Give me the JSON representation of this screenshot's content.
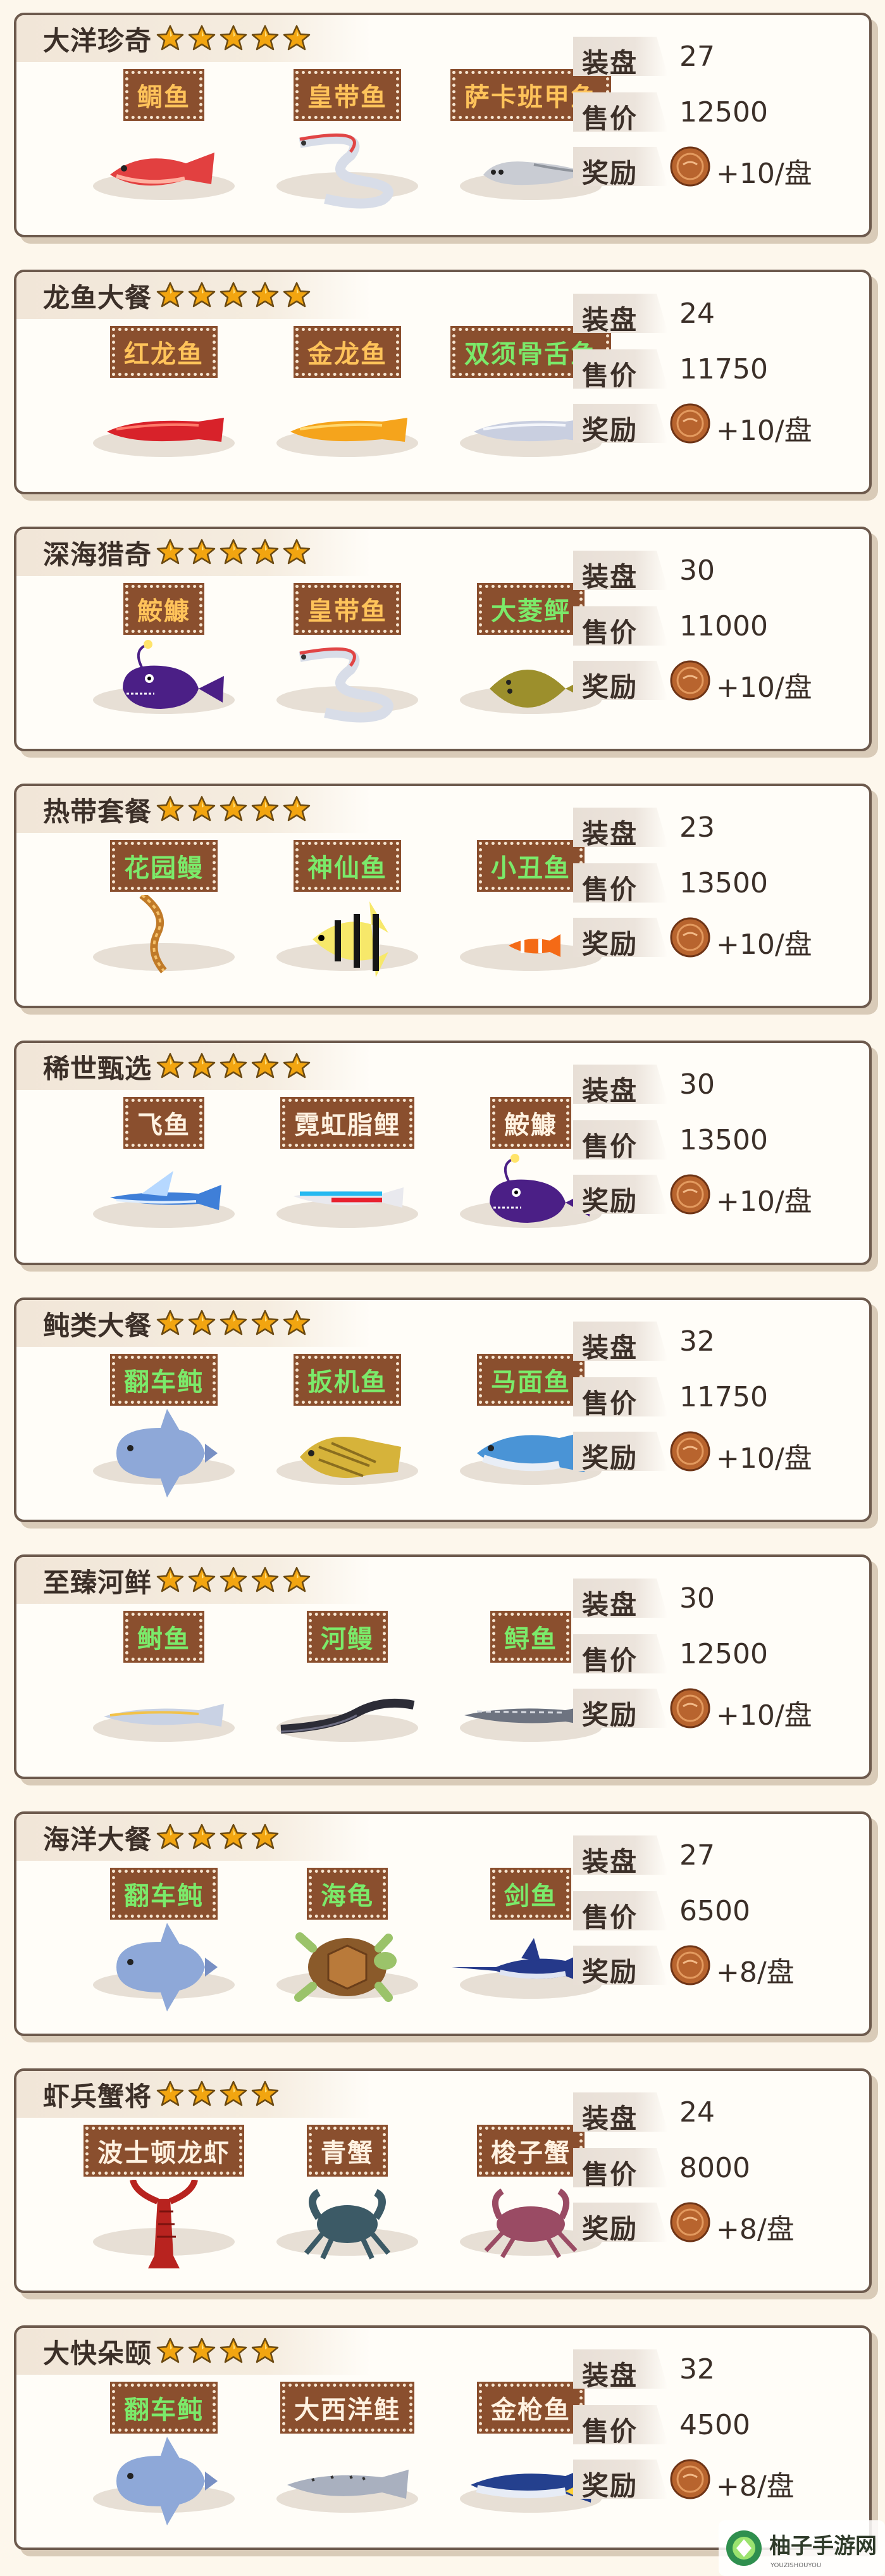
{
  "labels": {
    "plate": "装盘",
    "price": "售价",
    "reward": "奖励"
  },
  "colors": {
    "tag_orange": "#ffc35a",
    "tag_green": "#7bea6a",
    "star_gold": "#f2a510"
  },
  "sets": [
    {
      "title": "大洋珍奇",
      "stars": 5,
      "fish": [
        {
          "name": "鲷鱼",
          "tag_color": "orange",
          "icon": "red-snapper-icon"
        },
        {
          "name": "皇带鱼",
          "tag_color": "orange",
          "icon": "oarfish-icon"
        },
        {
          "name": "萨卡班甲鱼",
          "tag_color": "orange",
          "icon": "sacabambaspis-icon"
        }
      ],
      "plate": "27",
      "price": "12500",
      "reward": "+10/盘"
    },
    {
      "title": "龙鱼大餐",
      "stars": 5,
      "fish": [
        {
          "name": "红龙鱼",
          "tag_color": "orange",
          "icon": "red-arowana-icon"
        },
        {
          "name": "金龙鱼",
          "tag_color": "orange",
          "icon": "golden-arowana-icon"
        },
        {
          "name": "双须骨舌鱼",
          "tag_color": "green",
          "icon": "silver-arowana-icon"
        }
      ],
      "plate": "24",
      "price": "11750",
      "reward": "+10/盘"
    },
    {
      "title": "深海猎奇",
      "stars": 5,
      "fish": [
        {
          "name": "鮟鱇",
          "tag_color": "orange",
          "icon": "anglerfish-icon"
        },
        {
          "name": "皇带鱼",
          "tag_color": "orange",
          "icon": "oarfish-icon"
        },
        {
          "name": "大菱鲆",
          "tag_color": "green",
          "icon": "turbot-icon"
        }
      ],
      "plate": "30",
      "price": "11000",
      "reward": "+10/盘"
    },
    {
      "title": "热带套餐",
      "stars": 5,
      "fish": [
        {
          "name": "花园鳗",
          "tag_color": "green",
          "icon": "garden-eel-icon"
        },
        {
          "name": "神仙鱼",
          "tag_color": "green",
          "icon": "angelfish-icon"
        },
        {
          "name": "小丑鱼",
          "tag_color": "green",
          "icon": "clownfish-icon"
        }
      ],
      "plate": "23",
      "price": "13500",
      "reward": "+10/盘"
    },
    {
      "title": "稀世甄选",
      "stars": 5,
      "fish": [
        {
          "name": "飞鱼",
          "tag_color": "white",
          "icon": "flying-fish-icon"
        },
        {
          "name": "霓虹脂鲤",
          "tag_color": "white",
          "icon": "neon-tetra-icon"
        },
        {
          "name": "鮟鱇",
          "tag_color": "white",
          "icon": "anglerfish-icon"
        }
      ],
      "plate": "30",
      "price": "13500",
      "reward": "+10/盘"
    },
    {
      "title": "鲀类大餐",
      "stars": 5,
      "fish": [
        {
          "name": "翻车鲀",
          "tag_color": "green",
          "icon": "sunfish-icon"
        },
        {
          "name": "扳机鱼",
          "tag_color": "green",
          "icon": "triggerfish-icon"
        },
        {
          "name": "马面鱼",
          "tag_color": "green",
          "icon": "leatherjacket-icon"
        }
      ],
      "plate": "32",
      "price": "11750",
      "reward": "+10/盘"
    },
    {
      "title": "至臻河鲜",
      "stars": 5,
      "fish": [
        {
          "name": "鲥鱼",
          "tag_color": "green",
          "icon": "shad-icon"
        },
        {
          "name": "河鳗",
          "tag_color": "green",
          "icon": "river-eel-icon"
        },
        {
          "name": "鲟鱼",
          "tag_color": "green",
          "icon": "sturgeon-icon"
        }
      ],
      "plate": "30",
      "price": "12500",
      "reward": "+10/盘"
    },
    {
      "title": "海洋大餐",
      "stars": 4,
      "fish": [
        {
          "name": "翻车鲀",
          "tag_color": "green",
          "icon": "sunfish-icon"
        },
        {
          "name": "海龟",
          "tag_color": "green",
          "icon": "sea-turtle-icon"
        },
        {
          "name": "剑鱼",
          "tag_color": "green",
          "icon": "swordfish-icon"
        }
      ],
      "plate": "27",
      "price": "6500",
      "reward": "+8/盘"
    },
    {
      "title": "虾兵蟹将",
      "stars": 4,
      "fish": [
        {
          "name": "波士顿龙虾",
          "tag_color": "white",
          "icon": "lobster-icon"
        },
        {
          "name": "青蟹",
          "tag_color": "white",
          "icon": "mud-crab-icon"
        },
        {
          "name": "梭子蟹",
          "tag_color": "white",
          "icon": "swimming-crab-icon"
        }
      ],
      "plate": "24",
      "price": "8000",
      "reward": "+8/盘"
    },
    {
      "title": "大快朵颐",
      "stars": 4,
      "fish": [
        {
          "name": "翻车鲀",
          "tag_color": "green",
          "icon": "sunfish-icon"
        },
        {
          "name": "大西洋鲑",
          "tag_color": "white",
          "icon": "atlantic-salmon-icon"
        },
        {
          "name": "金枪鱼",
          "tag_color": "white",
          "icon": "tuna-icon"
        }
      ],
      "plate": "32",
      "price": "4500",
      "reward": "+8/盘"
    }
  ]
}
